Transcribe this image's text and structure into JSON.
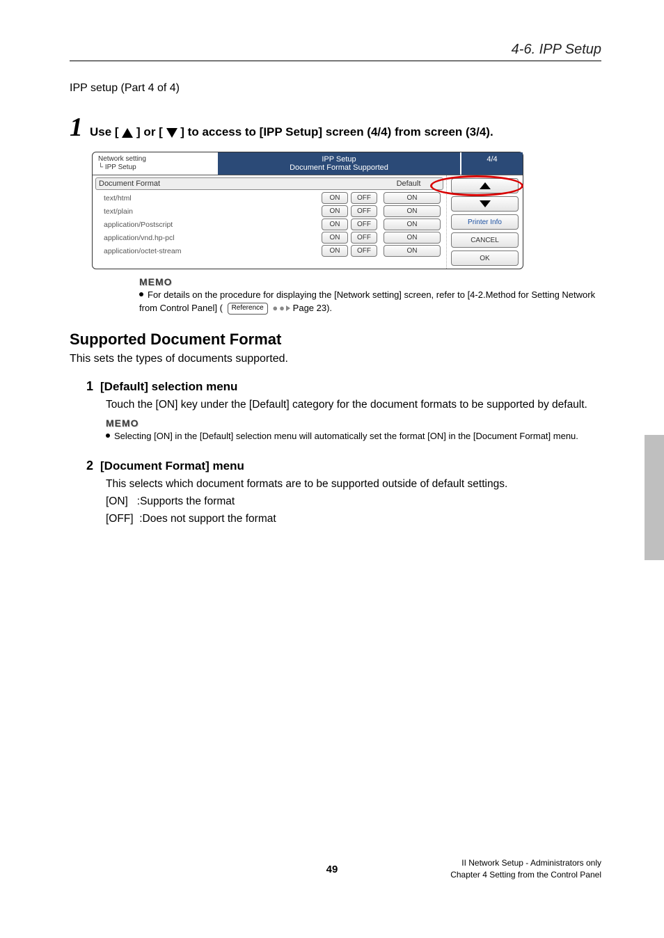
{
  "header": {
    "title": "4-6. IPP Setup"
  },
  "sub_heading": "IPP setup (Part 4 of 4)",
  "step1": {
    "number": "1",
    "pre": "Use [",
    "mid": "] or [",
    "post": "] to access to [IPP Setup] screen (4/4) from screen (3/4)."
  },
  "panel": {
    "breadcrumb_line1": "Network setting",
    "breadcrumb_line2": "└ IPP Setup",
    "title": "IPP Setup",
    "subtitle": "Document Format Supported",
    "page_indicator": "4/4",
    "th_format": "Document Format",
    "th_default": "Default",
    "on": "ON",
    "off": "OFF",
    "rows": [
      {
        "label": "text/html"
      },
      {
        "label": "text/plain"
      },
      {
        "label": "application/Postscript"
      },
      {
        "label": "application/vnd.hp-pcl"
      },
      {
        "label": "application/octet-stream"
      }
    ],
    "side": {
      "printer_info": "Printer Info",
      "cancel": "CANCEL",
      "ok": "OK"
    }
  },
  "memo1": {
    "label": "MEMO",
    "text_a": "For details on the procedure for displaying the [Network setting] screen, refer to [4-2.Method for Setting Network from Control Panel] (",
    "ref": "Reference",
    "text_b": " Page 23)."
  },
  "section": {
    "title": "Supported Document Format",
    "desc": "This sets the types of documents supported."
  },
  "items": [
    {
      "num": "1",
      "title": "[Default] selection menu",
      "body": "Touch the [ON] key under the [Default] category for the document formats to be supported by default.",
      "memo_label": "MEMO",
      "memo": "Selecting [ON] in the [Default] selection menu will automatically set the format [ON] in the [Document Format] menu."
    },
    {
      "num": "2",
      "title": "[Document Format] menu",
      "body": "This selects which document formats are to be supported outside of default settings.",
      "lines": [
        "[ON]   :Supports the format",
        "[OFF]  :Does not support the format"
      ]
    }
  ],
  "page_number": "49",
  "footer": {
    "line1": "II Network Setup - Administrators only",
    "line2": "Chapter 4 Setting from the Control Panel"
  }
}
